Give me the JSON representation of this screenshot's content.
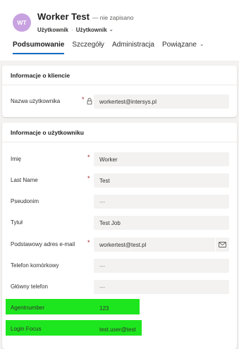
{
  "header": {
    "avatar_initials": "WT",
    "title": "Worker Test",
    "status": "— nie zapisano",
    "entity": "Użytkownik",
    "separator": "·",
    "form_name": "Użytkownik"
  },
  "tabs": [
    {
      "label": "Podsumowanie",
      "active": true
    },
    {
      "label": "Szczegóły",
      "active": false
    },
    {
      "label": "Administracja",
      "active": false
    },
    {
      "label": "Powiązane",
      "active": false
    }
  ],
  "sections": {
    "client": {
      "title": "Informacje o kliencie",
      "fields": [
        {
          "label": "Nazwa użytkownika",
          "required": "*",
          "value": "workertest@intersys.pl"
        }
      ]
    },
    "user": {
      "title": "Informacje o użytkowniku",
      "fields": [
        {
          "label": "Imię",
          "required": "*",
          "value": "Worker"
        },
        {
          "label": "Last Name",
          "required": "*",
          "value": "Test"
        },
        {
          "label": "Pseudonim",
          "value": "---"
        },
        {
          "label": "Tytuł",
          "value": "Test Job"
        },
        {
          "label": "Podstawowy adres e-mail",
          "required": "*",
          "value": "workertest@test.pl"
        },
        {
          "label": "Telefon komórkowy",
          "value": "---"
        },
        {
          "label": "Główny telefon",
          "value": "---"
        },
        {
          "label": "Agentnumber",
          "value": "123"
        },
        {
          "label": "Login Focus",
          "value": "test.user@test"
        }
      ]
    }
  },
  "colors": {
    "accent": "#0f6cbd",
    "required": "#a4262c",
    "highlight": "#1ee61e",
    "avatar": "#c8a2e0"
  }
}
